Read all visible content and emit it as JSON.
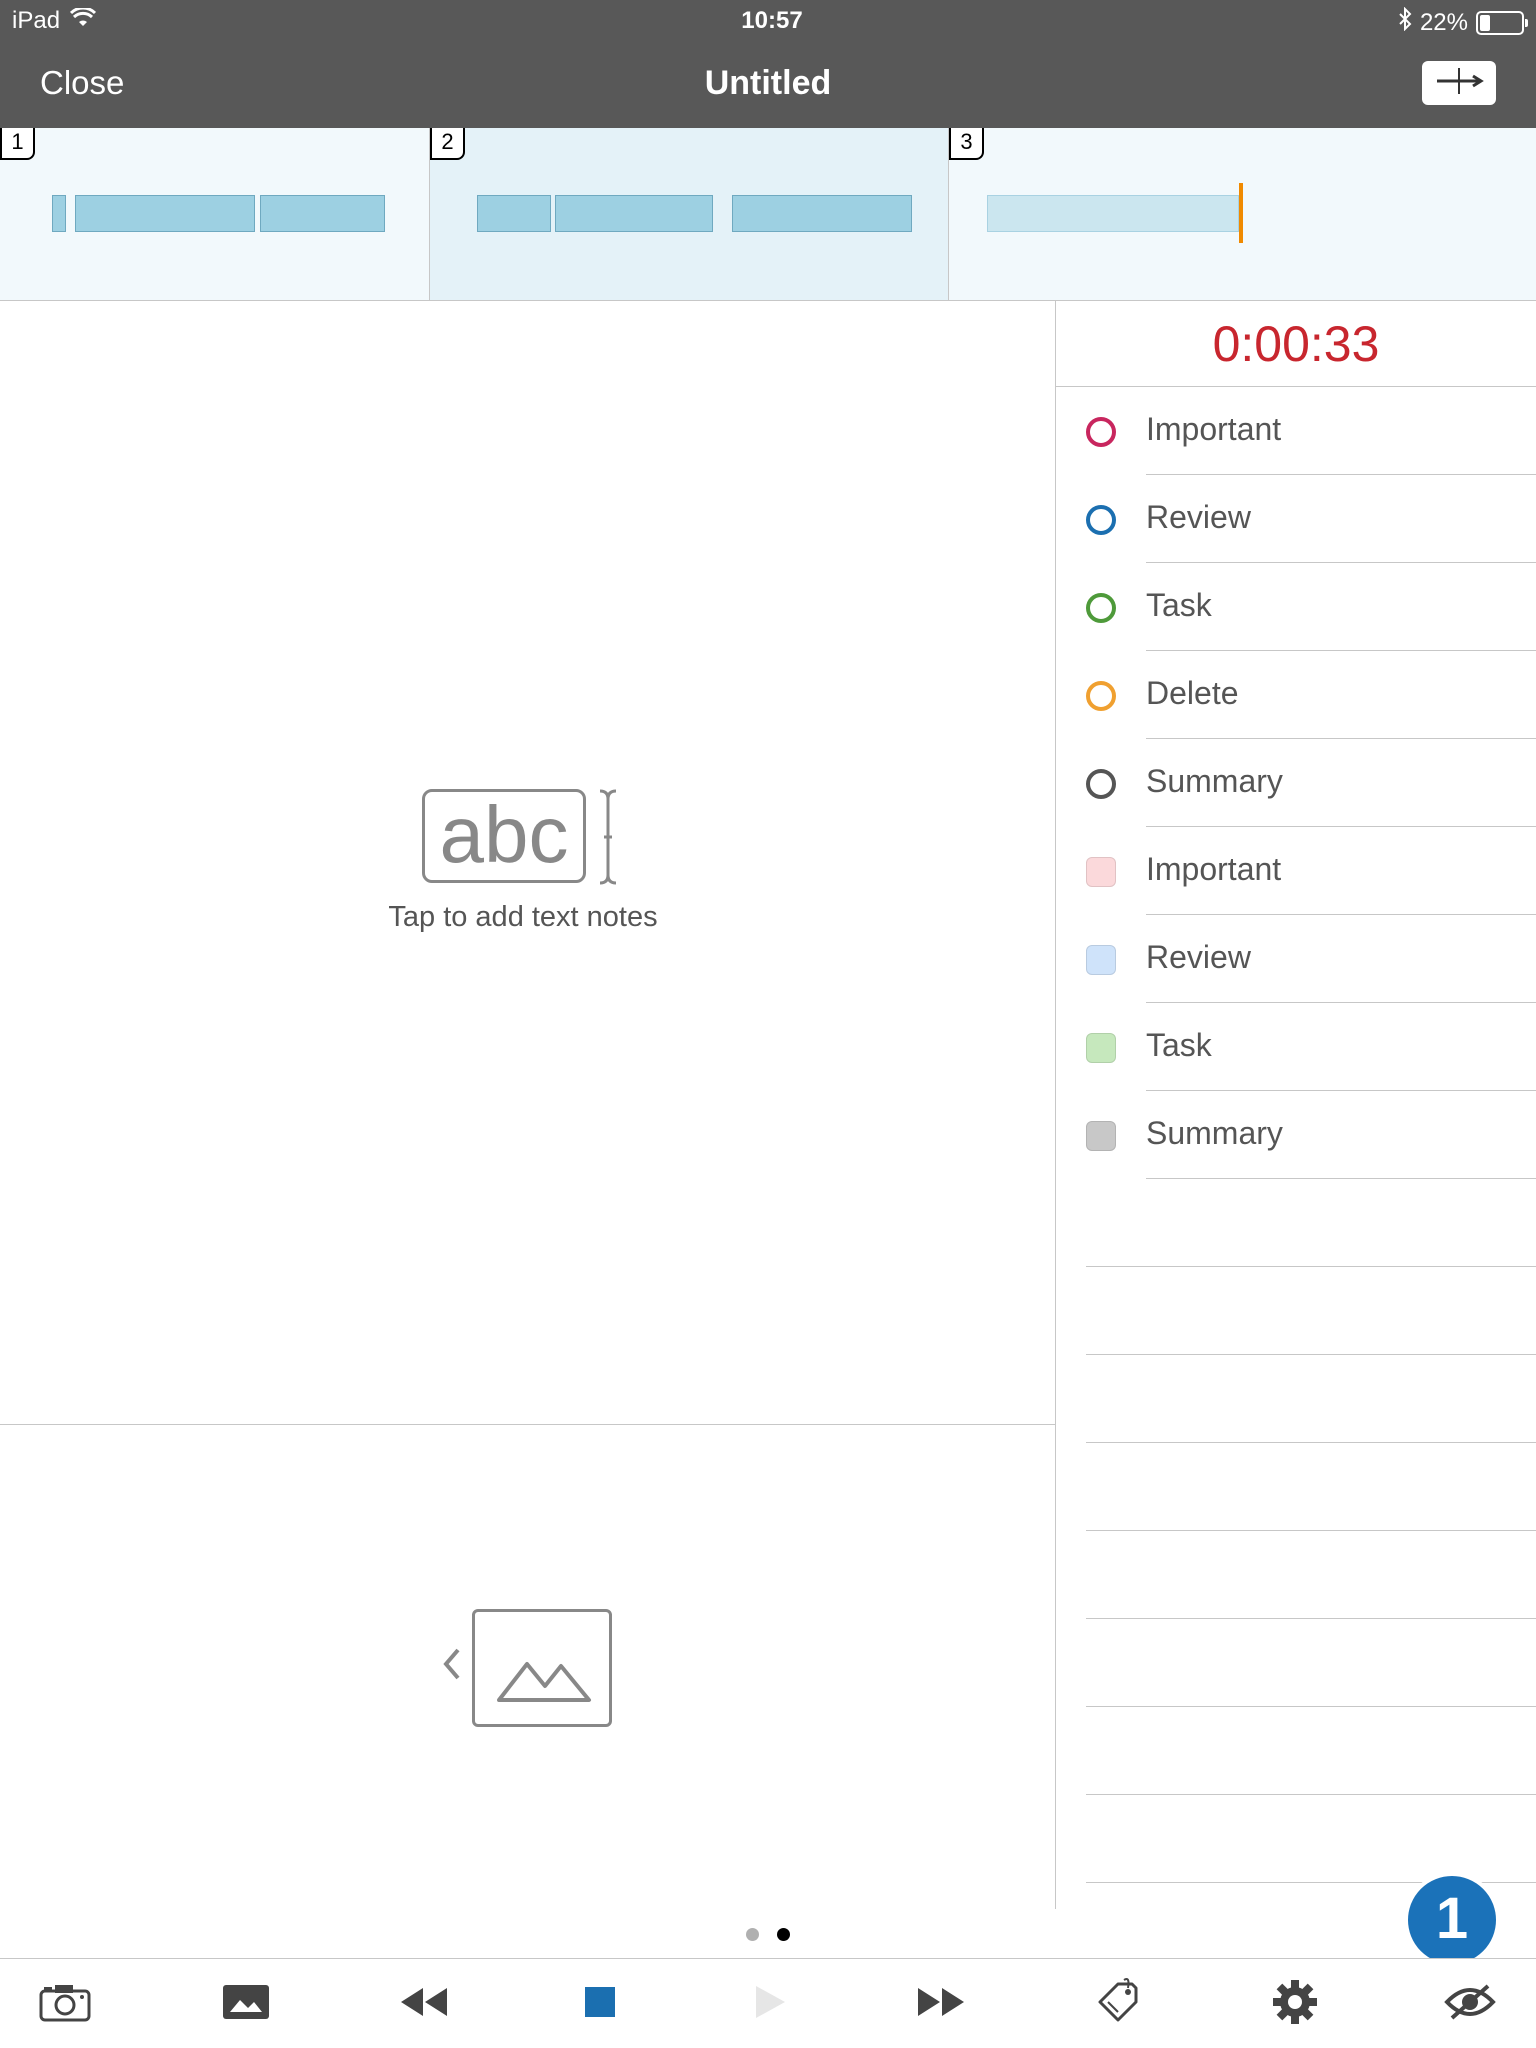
{
  "status_bar": {
    "device": "iPad",
    "time": "10:57",
    "battery": "22%"
  },
  "nav": {
    "close_label": "Close",
    "title": "Untitled"
  },
  "tracks": [
    {
      "number": "1"
    },
    {
      "number": "2"
    },
    {
      "number": "3"
    }
  ],
  "text_pane": {
    "icon_text": "abc",
    "hint": "Tap to add text notes"
  },
  "timer": "0:00:33",
  "tags": [
    {
      "label": "Important",
      "style": "ring",
      "color": "#c8265e"
    },
    {
      "label": "Review",
      "style": "ring",
      "color": "#1b6fb0"
    },
    {
      "label": "Task",
      "style": "ring",
      "color": "#4e9a3a"
    },
    {
      "label": "Delete",
      "style": "ring",
      "color": "#f0a030"
    },
    {
      "label": "Summary",
      "style": "ring",
      "color": "#555555"
    },
    {
      "label": "Important",
      "style": "fill",
      "color": "#fbd9db"
    },
    {
      "label": "Review",
      "style": "fill",
      "color": "#cfe3fa"
    },
    {
      "label": "Task",
      "style": "fill",
      "color": "#c6e8bd"
    },
    {
      "label": "Summary",
      "style": "fill",
      "color": "#c8c8c8"
    }
  ],
  "page_dots": {
    "count": 2,
    "current": 2
  },
  "badge_count": "1",
  "toolbar": {
    "icons": [
      "camera-icon",
      "photo-icon",
      "rewind-icon",
      "stop-icon",
      "play-icon",
      "fast-forward-icon",
      "tag-icon",
      "settings-gear-icon",
      "hide-eye-icon"
    ]
  },
  "colors": {
    "bar_bg": "#585858",
    "timer": "#c8262e",
    "accent": "#1b72b9",
    "playhead": "#f08a00"
  }
}
